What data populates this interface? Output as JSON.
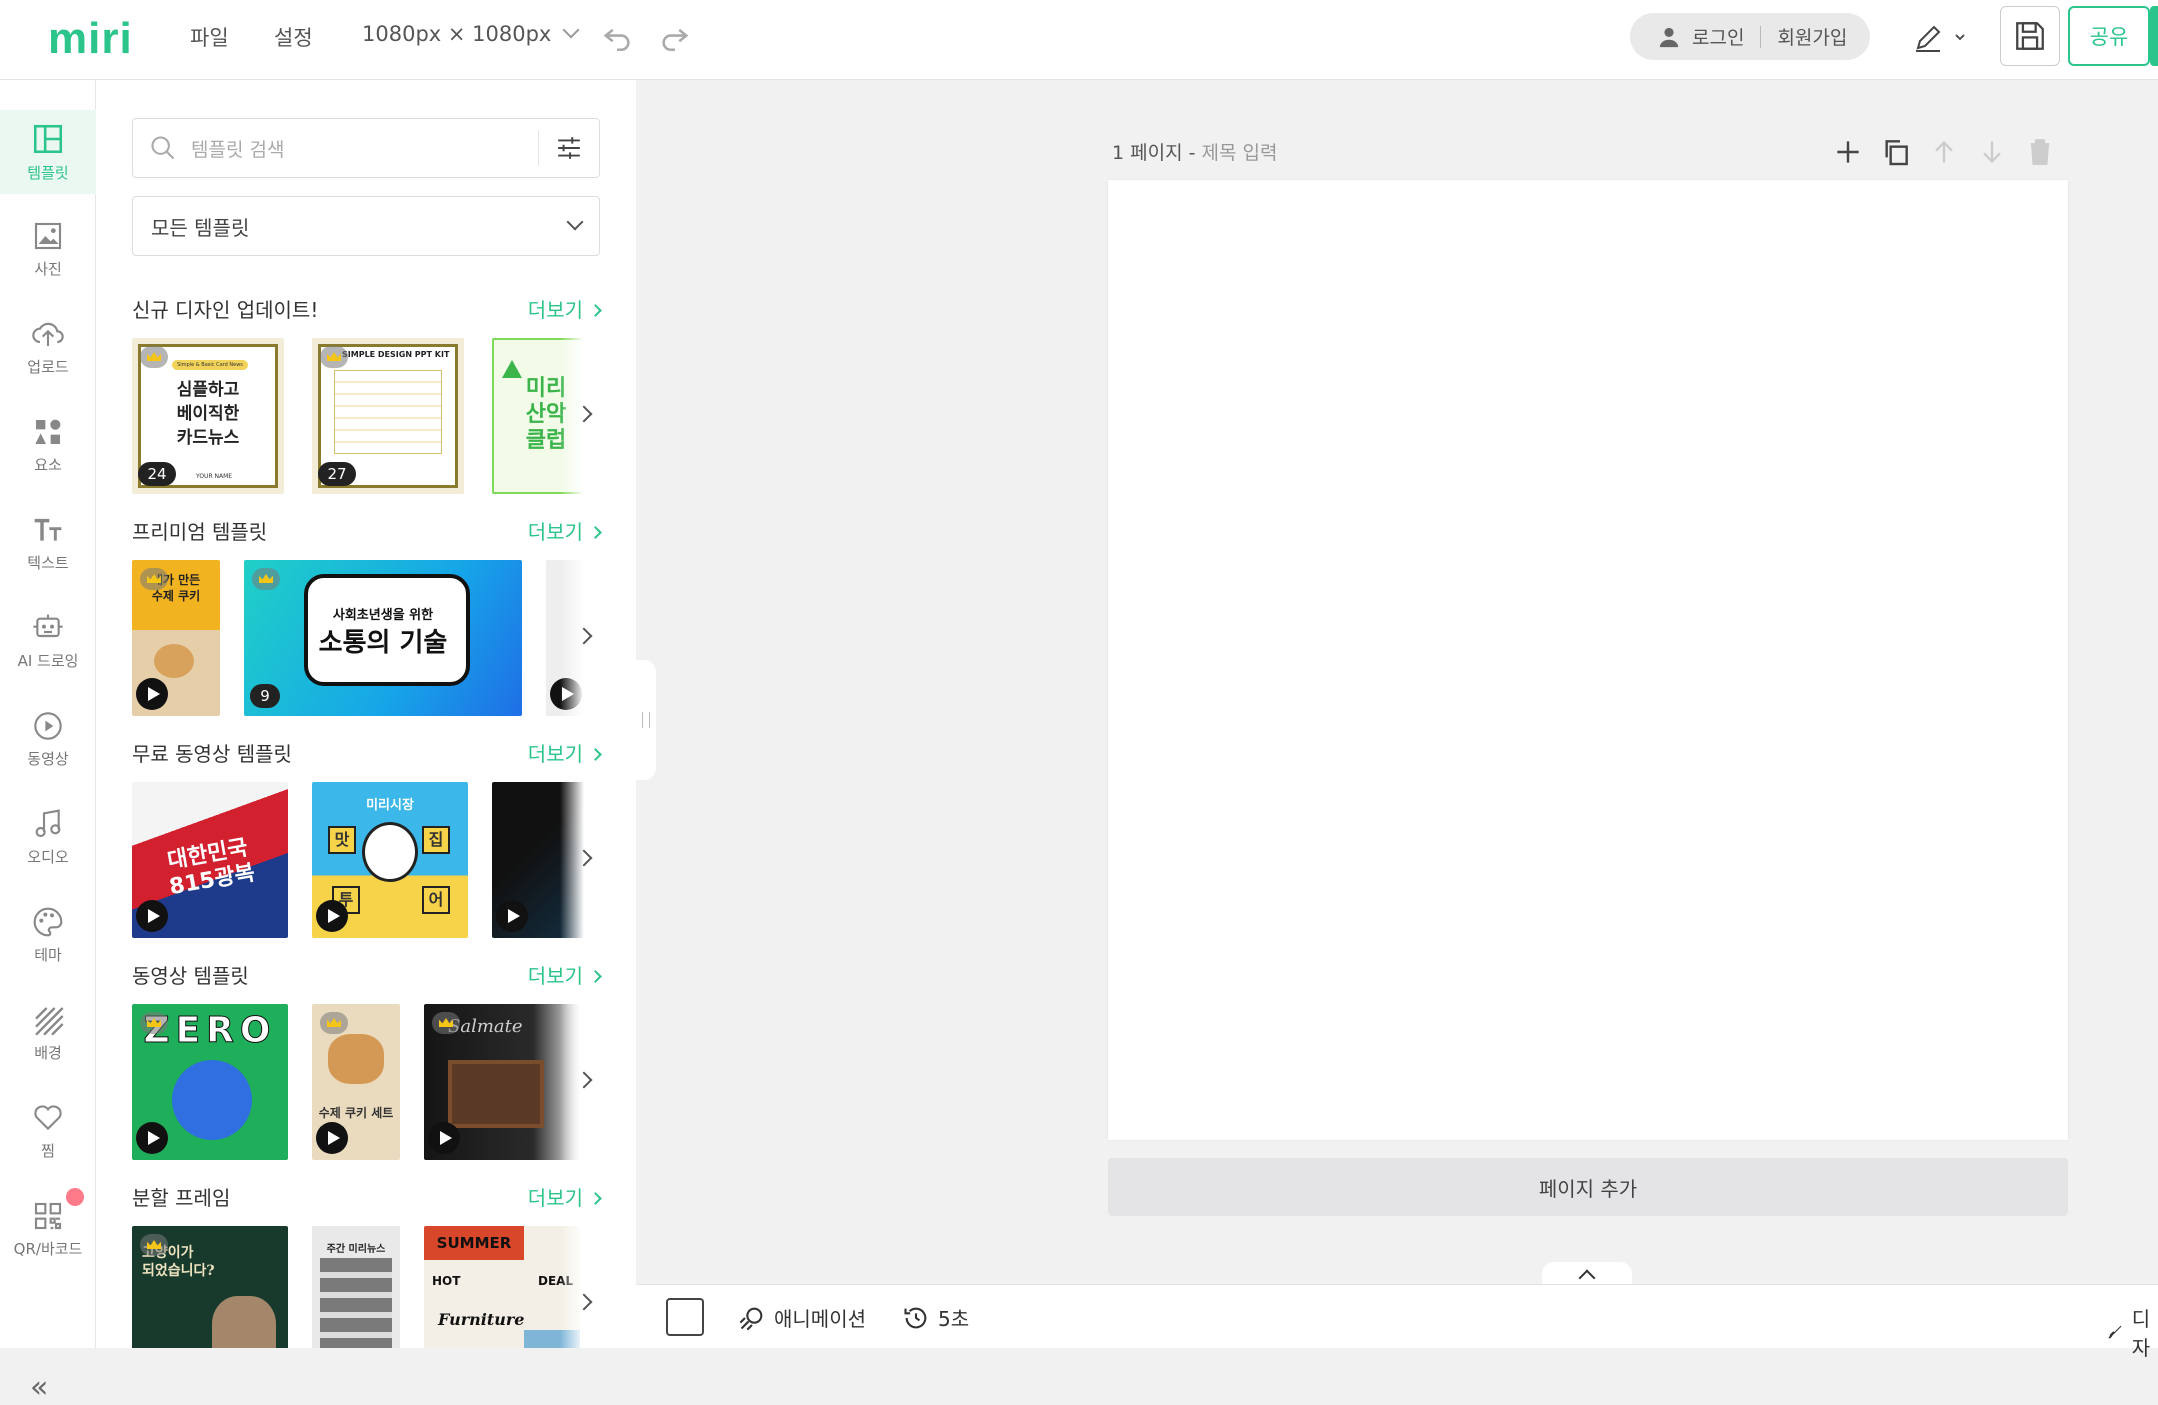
{
  "app": {
    "logo": "miri"
  },
  "topbar": {
    "menu": [
      "파일",
      "설정"
    ],
    "canvas_size": "1080px × 1080px",
    "login": "로그인",
    "signup": "회원가입",
    "share": "공유"
  },
  "rail": {
    "items": [
      {
        "label": "템플릿",
        "icon": "template-icon",
        "active": true
      },
      {
        "label": "사진",
        "icon": "photo-icon"
      },
      {
        "label": "업로드",
        "icon": "upload-icon"
      },
      {
        "label": "요소",
        "icon": "elements-icon"
      },
      {
        "label": "텍스트",
        "icon": "text-icon"
      },
      {
        "label": "AI 드로잉",
        "icon": "ai-drawing-icon"
      },
      {
        "label": "동영상",
        "icon": "video-icon"
      },
      {
        "label": "오디오",
        "icon": "audio-icon"
      },
      {
        "label": "테마",
        "icon": "palette-icon"
      },
      {
        "label": "배경",
        "icon": "background-icon"
      },
      {
        "label": "찜",
        "icon": "heart-icon"
      },
      {
        "label": "QR/바코드",
        "icon": "qr-icon"
      }
    ],
    "collapse": "«"
  },
  "panel": {
    "search_placeholder": "템플릿 검색",
    "filter_selected": "모든 템플릿",
    "more_label": "더보기",
    "sections": [
      {
        "title": "신규 디자인 업데이트!"
      },
      {
        "title": "프리미엄 템플릿"
      },
      {
        "title": "무료 동영상 템플릿"
      },
      {
        "title": "동영상 템플릿"
      },
      {
        "title": "분할 프레임"
      }
    ],
    "thumb_texts": {
      "card_news_pill": "Simple & Basic Card News",
      "card_news_title": "심플하고\n베이직한\n카드뉴스",
      "card_news_name": "YOUR NAME",
      "card_news_count": "24",
      "ppt_title": "SIMPLE DESIGN PPT KIT",
      "ppt_count": "27",
      "green_title": "미리\n산악\n클럽",
      "cookie_title": "내가 만든\n수제 쿠키",
      "comm_sub": "사회초년생을 위한",
      "comm_title": "소통의 기술",
      "comm_count": "9",
      "korea_title": "대한민국\n815광복",
      "bear_top": "미리시장",
      "bear_words": [
        "맛",
        "집",
        "투",
        "어"
      ],
      "zero_title": "ZERO",
      "cookie_set": "수제 쿠키 세트",
      "retro_title": "Salmate",
      "cat_title": "고양이가\n되었습니다?",
      "news_title": "주간 미리뉴스",
      "summer_title": "SUMMER",
      "summer_hot": "HOT",
      "summer_deal": "DEAL",
      "summer_furniture": "Furniture"
    }
  },
  "page": {
    "label": "1 페이지",
    "title_placeholder": "제목 입력",
    "add_page": "페이지 추가"
  },
  "bottombar": {
    "animation": "애니메이션",
    "duration": "5초",
    "design_label": "디자"
  },
  "colors": {
    "accent": "#2bc48a"
  }
}
